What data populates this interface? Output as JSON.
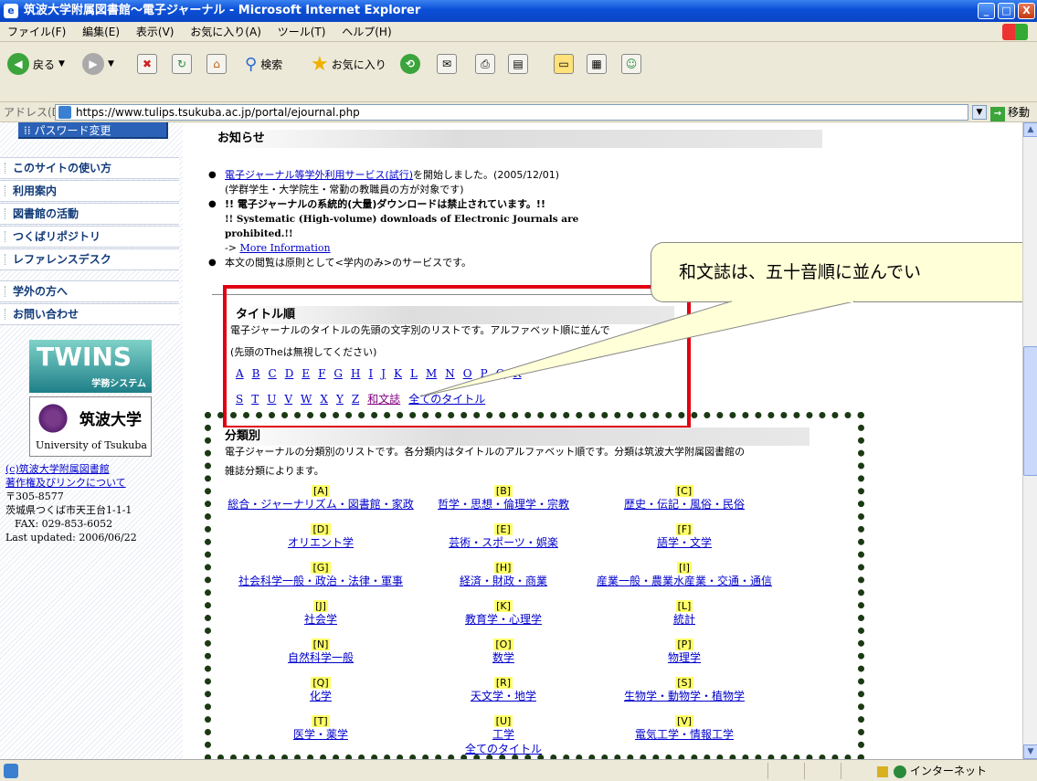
{
  "window": {
    "title": "筑波大学附属図書館〜電子ジャーナル - Microsoft Internet Explorer",
    "min": "_",
    "max": "□",
    "close": "X"
  },
  "menu": [
    "ファイル(F)",
    "編集(E)",
    "表示(V)",
    "お気に入り(A)",
    "ツール(T)",
    "ヘルプ(H)"
  ],
  "toolbar": {
    "back": "戻る",
    "search": "検索",
    "favorites": "お気に入り"
  },
  "address": {
    "label": "アドレス(D)",
    "url": "https://www.tulips.tsukuba.ac.jp/portal/ejournal.php",
    "go": "移動"
  },
  "sidebar": {
    "password": "パスワード変更",
    "items": [
      "このサイトの使い方",
      "利用案内",
      "図書館の活動",
      "つくばリポジトリ",
      "レファレンスデスク",
      "学外の方へ",
      "お問い合わせ"
    ],
    "twins": {
      "name": "TWINS",
      "sub": "学務システム"
    },
    "univ": {
      "jp": "筑波大学",
      "en": "University of Tsukuba"
    },
    "footer": {
      "copyright": "(c)筑波大学附属図書館",
      "link": "著作権及びリンクについて",
      "postal": "〒305-8577",
      "address": "茨城県つくば市天王台1-1-1",
      "fax": "FAX: 029-853-6052",
      "updated": "Last updated: 2006/06/22"
    }
  },
  "news": {
    "heading": "お知らせ",
    "item1_link": "電子ジャーナル等学外利用サービス(試行)",
    "item1_rest": "を開始しました。(2005/12/01)",
    "item1_note": "(学群学生・大学院生・常勤の教職員の方が対象です)",
    "item2_jp": "!! 電子ジャーナルの系統的(大量)ダウンロードは禁止されています。!!",
    "item2_en": "!! Systematic (High-volume) downloads of Electronic Journals are prohibited.!!",
    "item2_arrow": "->",
    "item2_link": "More Information",
    "item3": "本文の閲覧は原則として<学内のみ>のサービスです。"
  },
  "title_order": {
    "heading": "タイトル順",
    "desc": "電子ジャーナルのタイトルの先頭の文字別のリストです。アルファベット順に並んで",
    "note": "(先頭のTheは無視してください)",
    "row1": [
      "A",
      "B",
      "C",
      "D",
      "E",
      "F",
      "G",
      "H",
      "I",
      "J",
      "K",
      "L",
      "M",
      "N",
      "O",
      "P",
      "Q",
      "R"
    ],
    "row2": [
      "S",
      "T",
      "U",
      "V",
      "W",
      "X",
      "Y",
      "Z"
    ],
    "japanese": "和文誌",
    "all": "全てのタイトル"
  },
  "classification": {
    "heading": "分類別",
    "desc1": "電子ジャーナルの分類別のリストです。各分類内はタイトルのアルファベット順です。分類は筑波大学附属図書館の",
    "desc2": "雑誌分類によります。",
    "cells": [
      {
        "code": "[A]",
        "label": "総合・ジャーナリズム・図書館・家政"
      },
      {
        "code": "[B]",
        "label": "哲学・思想・倫理学・宗教"
      },
      {
        "code": "[C]",
        "label": "歴史・伝記・風俗・民俗"
      },
      {
        "code": "[D]",
        "label": "オリエント学"
      },
      {
        "code": "[E]",
        "label": "芸術・スポーツ・娯楽"
      },
      {
        "code": "[F]",
        "label": "語学・文学"
      },
      {
        "code": "[G]",
        "label": "社会科学一般・政治・法律・軍事"
      },
      {
        "code": "[H]",
        "label": "経済・財政・商業"
      },
      {
        "code": "[I]",
        "label": "産業一般・農業水産業・交通・通信"
      },
      {
        "code": "[J]",
        "label": "社会学"
      },
      {
        "code": "[K]",
        "label": "教育学・心理学"
      },
      {
        "code": "[L]",
        "label": "統計"
      },
      {
        "code": "[N]",
        "label": "自然科学一般"
      },
      {
        "code": "[O]",
        "label": "数学"
      },
      {
        "code": "[P]",
        "label": "物理学"
      },
      {
        "code": "[Q]",
        "label": "化学"
      },
      {
        "code": "[R]",
        "label": "天文学・地学"
      },
      {
        "code": "[S]",
        "label": "生物学・動物学・植物学"
      },
      {
        "code": "[T]",
        "label": "医学・薬学"
      },
      {
        "code": "[U]",
        "label": "工学"
      },
      {
        "code": "[V]",
        "label": "電気工学・情報工学"
      }
    ],
    "all": "全てのタイトル"
  },
  "callout": {
    "text": "和文誌は、五十音順に並んでい"
  },
  "status": {
    "zone": "インターネット"
  },
  "colors": {
    "highlight_red": "#e00010",
    "dotted_border": "#1b3a14",
    "callout_bg": "#ffffd8",
    "link": "#0000cc"
  }
}
